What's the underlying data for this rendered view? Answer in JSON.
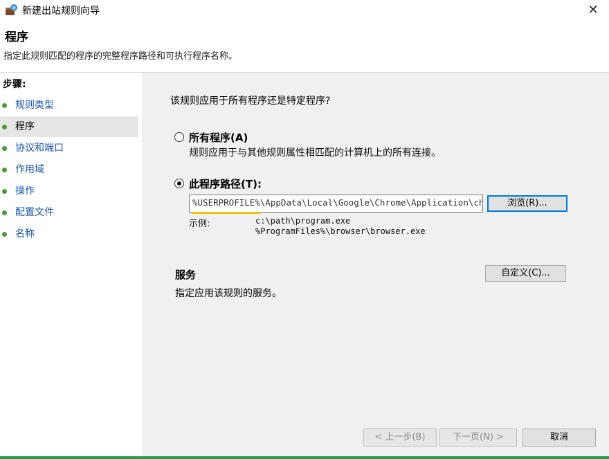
{
  "window": {
    "title": "新建出站规则向导",
    "close_symbol": "✕"
  },
  "header": {
    "title": "程序",
    "description": "指定此规则匹配的程序的完整程序路径和可执行程序名称。"
  },
  "sidebar": {
    "steps_label": "步骤:",
    "items": [
      {
        "label": "规则类型"
      },
      {
        "label": "程序"
      },
      {
        "label": "协议和端口"
      },
      {
        "label": "作用域"
      },
      {
        "label": "操作"
      },
      {
        "label": "配置文件"
      },
      {
        "label": "名称"
      }
    ]
  },
  "main": {
    "question": "该规则应用于所有程序还是特定程序?",
    "all_programs": {
      "label": "所有程序(A)",
      "description": "规则应用于与其他规则属性相匹配的计算机上的所有连接。",
      "selected": false
    },
    "this_program": {
      "label": "此程序路径(T):",
      "selected": true,
      "path_value": "%USERPROFILE%\\AppData\\Local\\Google\\Chrome\\Application\\ch",
      "browse_label": "浏览(R)...",
      "example_label": "示例:",
      "example_line1": "c:\\path\\program.exe",
      "example_line2": "%ProgramFiles%\\browser\\browser.exe"
    },
    "services": {
      "title": "服务",
      "description": "指定应用该规则的服务。",
      "customize_label": "自定义(C)..."
    }
  },
  "footer": {
    "back_label": "< 上一步(B)",
    "next_label": "下一页(N) >",
    "cancel_label": "取消"
  },
  "colors": {
    "accent": "#0078d7",
    "step_dot": "#4c9a35",
    "link": "#1a55a8",
    "highlight": "#f2c20c"
  }
}
